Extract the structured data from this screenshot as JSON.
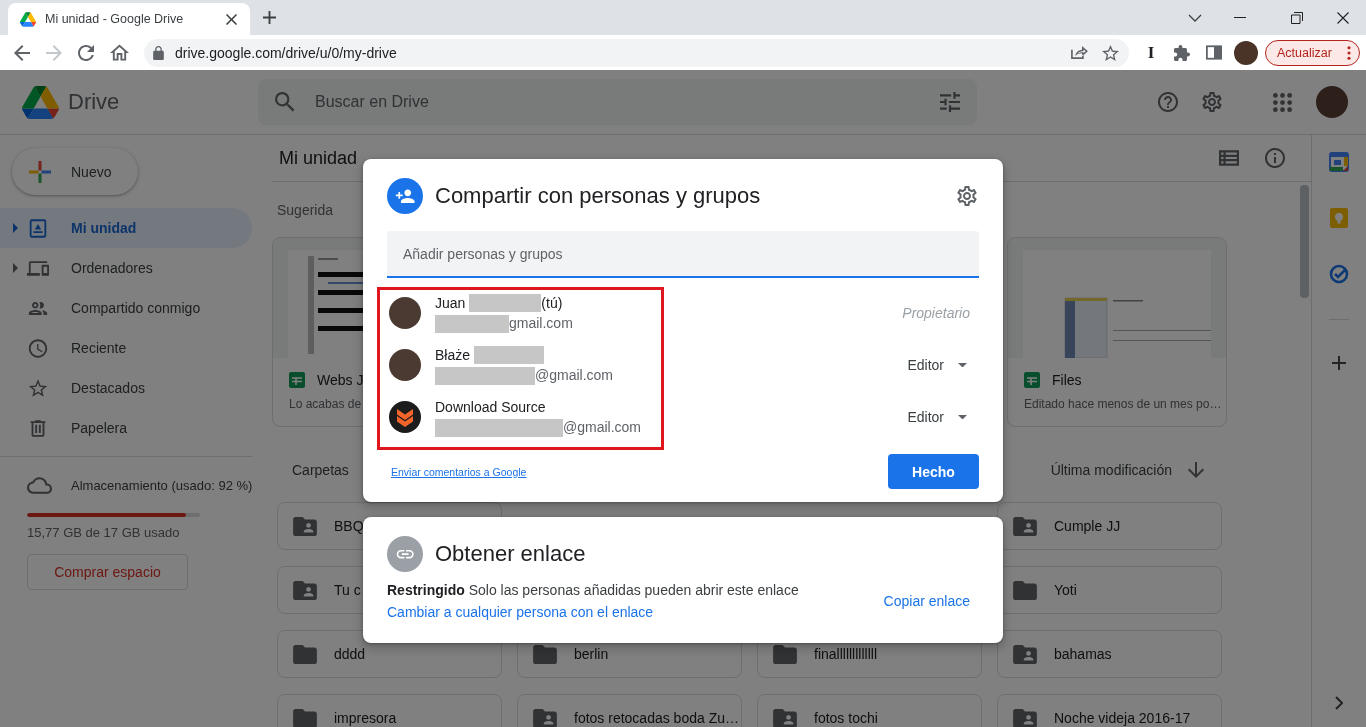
{
  "browser": {
    "tab": {
      "title": "Mi unidad - Google Drive",
      "selected": true
    },
    "forward_disabled": true,
    "url": "drive.google.com/drive/u/0/my-drive",
    "extension_glyph": "I",
    "update_button": "Actualizar"
  },
  "header": {
    "brand": "Drive",
    "search_placeholder": "Buscar en Drive"
  },
  "sidebar": {
    "new_button": "Nuevo",
    "items": [
      {
        "label": "Mi unidad",
        "selected": true,
        "expandable": true
      },
      {
        "label": "Ordenadores",
        "selected": false,
        "expandable": true
      },
      {
        "label": "Compartido conmigo",
        "selected": false,
        "expandable": false
      },
      {
        "label": "Reciente",
        "selected": false,
        "expandable": false
      },
      {
        "label": "Destacados",
        "selected": false,
        "expandable": false
      },
      {
        "label": "Papelera",
        "selected": false,
        "expandable": false
      }
    ],
    "storage": {
      "label": "Almacenamiento (usado: 92 %)",
      "level": 0.92,
      "detail": "15,77 GB de 17 GB usado",
      "button": "Comprar espacio"
    }
  },
  "main": {
    "title": "Mi unidad",
    "suggested": {
      "heading": "Sugerida",
      "cards": [
        {
          "name": "Webs J",
          "meta": "Lo acabas de"
        },
        {
          "name": "Files",
          "meta": "Editado hace menos de un mes po…"
        }
      ]
    },
    "folders": {
      "heading": "Carpetas",
      "sort": "Última modificación",
      "rows": [
        [
          {
            "name": "BBQ",
            "shared": true
          },
          {
            "name": "Cumple JJ",
            "shared": true
          }
        ],
        [
          {
            "name": "Tu c",
            "shared": true
          },
          {
            "name": "Yoti",
            "shared": false
          }
        ],
        [
          {
            "name": "dddd",
            "shared": false
          },
          {
            "name": "berlin",
            "shared": false
          },
          {
            "name": "finalllllllllllll",
            "shared": false
          },
          {
            "name": "bahamas",
            "shared": true
          }
        ],
        [
          {
            "name": "impresora",
            "shared": false
          },
          {
            "name": "fotos retocadas boda Zu…",
            "shared": true
          },
          {
            "name": "fotos tochi",
            "shared": true
          },
          {
            "name": "Noche videja 2016-17",
            "shared": true
          }
        ]
      ]
    }
  },
  "share_dialog": {
    "title": "Compartir con personas y grupos",
    "input_placeholder": "Añadir personas y grupos",
    "highlighted": true,
    "people": [
      {
        "kind": "photo",
        "name": "Juan",
        "name_redacted": true,
        "suffix": "(tú)",
        "email": "gmail.com",
        "email_redacted": true,
        "role": "Propietario",
        "role_editable": false
      },
      {
        "kind": "photo",
        "name": "Błaże",
        "name_redacted": true,
        "email": "@gmail.com",
        "email_redacted": true,
        "role": "Editor",
        "role_editable": true
      },
      {
        "kind": "logo",
        "name": "Download Source",
        "name_redacted": false,
        "email": "@gmail.com",
        "email_redacted": true,
        "role": "Editor",
        "role_editable": true
      }
    ],
    "feedback_link": "Enviar comentarios a Google",
    "done_button": "Hecho"
  },
  "link_dialog": {
    "title": "Obtener enlace",
    "description": "**Restringido** Solo las personas añadidas pueden abrir este enlace",
    "change_link": "Cambiar a cualquier persona con el enlace",
    "copy_button": "Copiar enlace"
  }
}
